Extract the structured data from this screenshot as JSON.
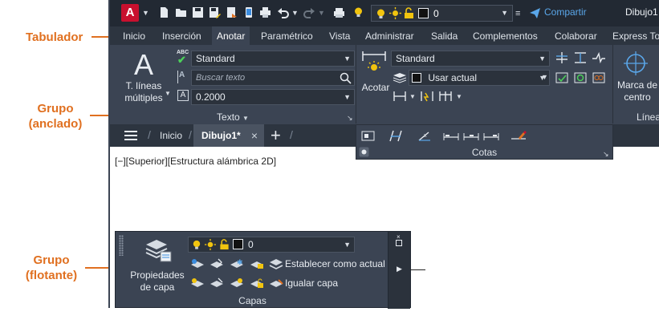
{
  "callouts": {
    "tab_bar": "Tabulador",
    "docked_panel_line1": "Grupo",
    "docked_panel_line2": "(anclado)",
    "floating_panel_line1": "Grupo",
    "floating_panel_line2": "(flotante)"
  },
  "app": {
    "logo_letter": "A",
    "share_label": "Compartir",
    "title": "Dibujo1",
    "layer_value": "0"
  },
  "colors": {
    "accent": "#e07020",
    "ribbon_bg": "#3b4453",
    "qat_bg": "#222933",
    "autocad_red": "#c8102e",
    "share_blue": "#5aa7ea"
  },
  "tabs": [
    "Inicio",
    "Inserción",
    "Anotar",
    "Paramétrico",
    "Vista",
    "Administrar",
    "Salida",
    "Complementos",
    "Colaborar",
    "Express Tools"
  ],
  "active_tab": "Anotar",
  "ribbon": {
    "text_panel": {
      "title": "Texto",
      "big_button_line1": "T. líneas",
      "big_button_line2": "múltiples",
      "style_value": "Standard",
      "search_placeholder": "Buscar texto",
      "height_value": "0.2000",
      "abc_icon": "ABC"
    },
    "dim_panel": {
      "title": "Cotas",
      "big_button": "Acotar",
      "style_value": "Standard",
      "layer_value": "Usar actual"
    },
    "center_panel": {
      "line1": "Marca de",
      "line2": "centro",
      "title": "Líneas"
    }
  },
  "file_tabs": {
    "home": "Inicio",
    "drawing": "Dibujo1*",
    "close_icon": "×",
    "add_icon": "+"
  },
  "viewport": {
    "label": "[−][Superior][Estructura alámbrica 2D]"
  },
  "floating_panel": {
    "big_button_line1": "Propiedades",
    "big_button_line2": "de capa",
    "layer_value": "0",
    "set_current": "Establecer como actual",
    "match_layer": "Igualar capa",
    "title": "Capas"
  }
}
